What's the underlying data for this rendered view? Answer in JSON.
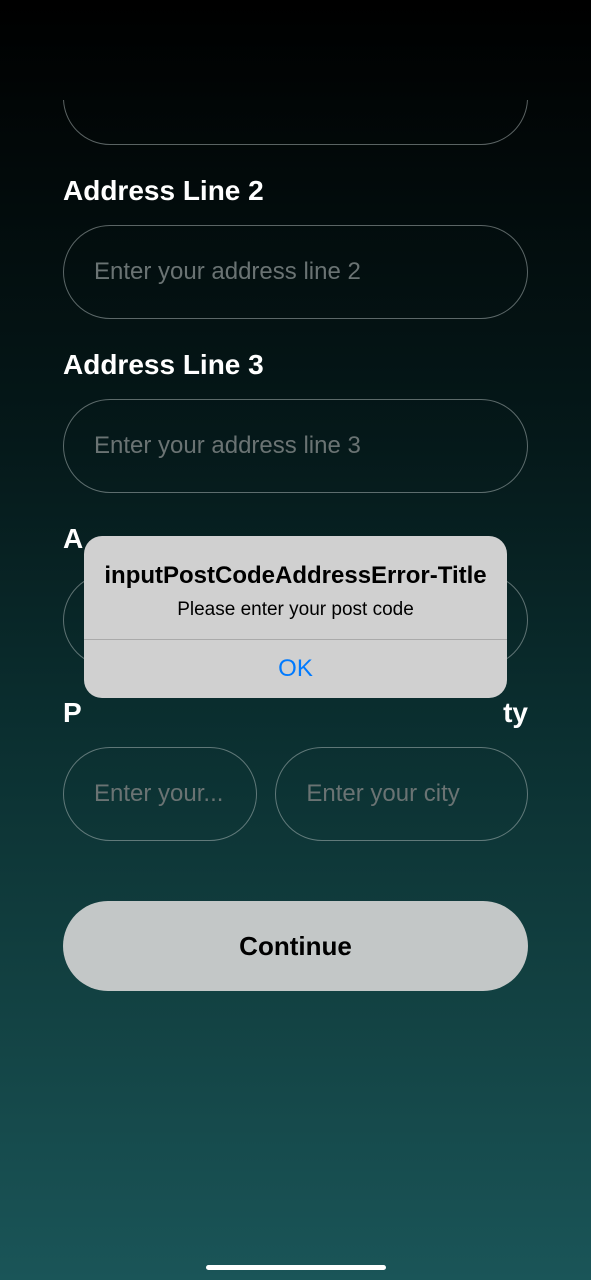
{
  "form": {
    "address_line_2": {
      "label": "Address Line 2",
      "placeholder": "Enter your address line 2",
      "value": ""
    },
    "address_line_3": {
      "label": "Address Line 3",
      "placeholder": "Enter your address line 3",
      "value": ""
    },
    "address_partial": {
      "label_prefix": "A"
    },
    "post_city_row": {
      "post_label_prefix": "P",
      "city_label_suffix": "ty",
      "post": {
        "placeholder": "Enter your...",
        "value": ""
      },
      "city": {
        "placeholder": "Enter your city",
        "value": ""
      }
    },
    "continue_label": "Continue"
  },
  "modal": {
    "title": "inputPostCodeAddressError-Title",
    "message": "Please enter your post code",
    "ok_label": "OK"
  }
}
